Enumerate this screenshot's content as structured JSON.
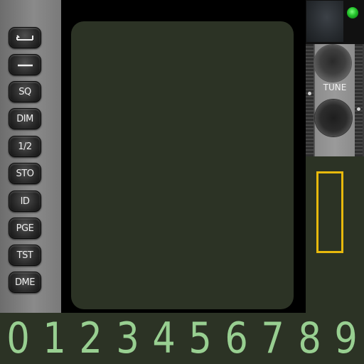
{
  "buttons": [
    {
      "name": "seq-1-button",
      "label": "",
      "icon": "arrow-return-icon"
    },
    {
      "name": "seq-2-button",
      "label": "",
      "icon": "dash-icon"
    },
    {
      "name": "sq-button",
      "label": "SQ"
    },
    {
      "name": "dim-button",
      "label": "DIM"
    },
    {
      "name": "half-button",
      "label": "1/2"
    },
    {
      "name": "sto-button",
      "label": "STO"
    },
    {
      "name": "id-button",
      "label": "ID"
    },
    {
      "name": "pge-button",
      "label": "PGE"
    },
    {
      "name": "tst-button",
      "label": "TST"
    },
    {
      "name": "dme-button",
      "label": "DME"
    }
  ],
  "knobs": {
    "tune_label": "TUNE"
  },
  "indicator": {
    "color": "#22c22a"
  },
  "highlight_color": "#e8b90c",
  "screen_color": "#2c3325",
  "digits": [
    "0",
    "1",
    "2",
    "3",
    "4",
    "5",
    "6",
    "7",
    "8",
    "9"
  ],
  "digit_color": "#98cf91"
}
